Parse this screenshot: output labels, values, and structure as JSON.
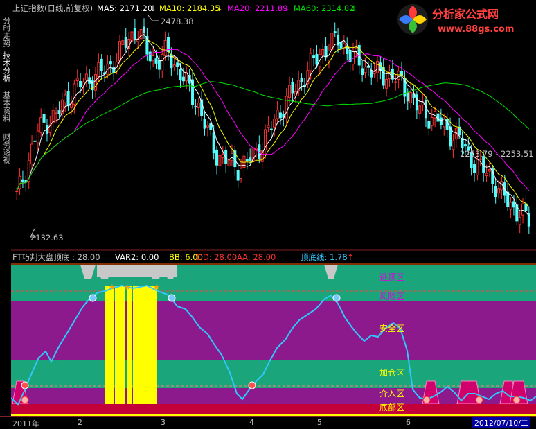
{
  "sidebar": {
    "tabs": [
      {
        "label": "分时走势",
        "active": false
      },
      {
        "label": "技术分析",
        "active": true
      },
      {
        "label": "基本资料",
        "active": false
      },
      {
        "label": "财务透视",
        "active": false
      }
    ]
  },
  "logo": {
    "brand": "分析家公式网",
    "url": "www.88gs.com"
  },
  "main_header": {
    "title": "上证指数(日线,前复权)",
    "ma5": "MA5: 2171.20",
    "ma10": "MA10: 2184.35",
    "ma20": "MA20: 2211.89",
    "ma60": "MA60: 2314.82",
    "arrow": "↓"
  },
  "price_labels": {
    "high": "2478.38",
    "low": "2132.63",
    "cursor": "2253.79 - 2253.51"
  },
  "indicator_header": {
    "title": "FT巧判大盘顶底 : 28.00",
    "var2": "VAR2: 0.00",
    "bb": "BB: 6.00",
    "dd": "DD: 28.00",
    "aa": "AA: 28.00",
    "topline": "顶底线: 1.78",
    "arrow": "↑"
  },
  "zones": [
    {
      "label": "逃顶区",
      "color": "#e000e0"
    },
    {
      "label": "风险区",
      "color": "#e000e0"
    },
    {
      "label": "安全区",
      "color": "#ffff00"
    },
    {
      "label": "加仓区",
      "color": "#ffff00"
    },
    {
      "label": "介入区",
      "color": "#ffff00"
    },
    {
      "label": "底部区",
      "color": "#ffff00"
    }
  ],
  "time_axis": {
    "labels": [
      "2011年",
      "2",
      "3",
      "4",
      "5",
      "6"
    ],
    "cursor_date": "2012/07/10/二"
  },
  "colors": {
    "up": "#ff3030",
    "down": "#54fcfc",
    "ma5": "#ffffff",
    "ma10": "#ffff00",
    "ma20": "#ff00ff",
    "ma60": "#00e000",
    "topline": "#30c8ff"
  },
  "chart_data": [
    {
      "type": "candlestick",
      "title": "上证指数(日线,前复权)",
      "series": [
        {
          "name": "MA5",
          "last": 2171.2
        },
        {
          "name": "MA10",
          "last": 2184.35
        },
        {
          "name": "MA20",
          "last": 2211.89
        },
        {
          "name": "MA60",
          "last": 2314.82
        }
      ],
      "annotations": [
        {
          "text": "2478.38",
          "kind": "high"
        },
        {
          "text": "2132.63",
          "kind": "low"
        }
      ],
      "close_path": [
        2190,
        2240,
        2300,
        2320,
        2330,
        2360,
        2380,
        2390,
        2400,
        2410,
        2430,
        2460,
        2478,
        2440,
        2420,
        2440,
        2410,
        2380,
        2350,
        2300,
        2260,
        2250,
        2240,
        2250,
        2270,
        2300,
        2330,
        2360,
        2380,
        2410,
        2430,
        2450,
        2460,
        2440,
        2420,
        2410,
        2400,
        2400,
        2390,
        2370,
        2340,
        2330,
        2320,
        2300,
        2290,
        2260,
        2240,
        2230,
        2200,
        2180,
        2160,
        2150
      ],
      "ylim": [
        2110,
        2500
      ]
    },
    {
      "type": "line",
      "title": "FT巧判大盘顶底",
      "series": [
        {
          "name": "顶底线",
          "last": 1.78
        }
      ]
    }
  ]
}
